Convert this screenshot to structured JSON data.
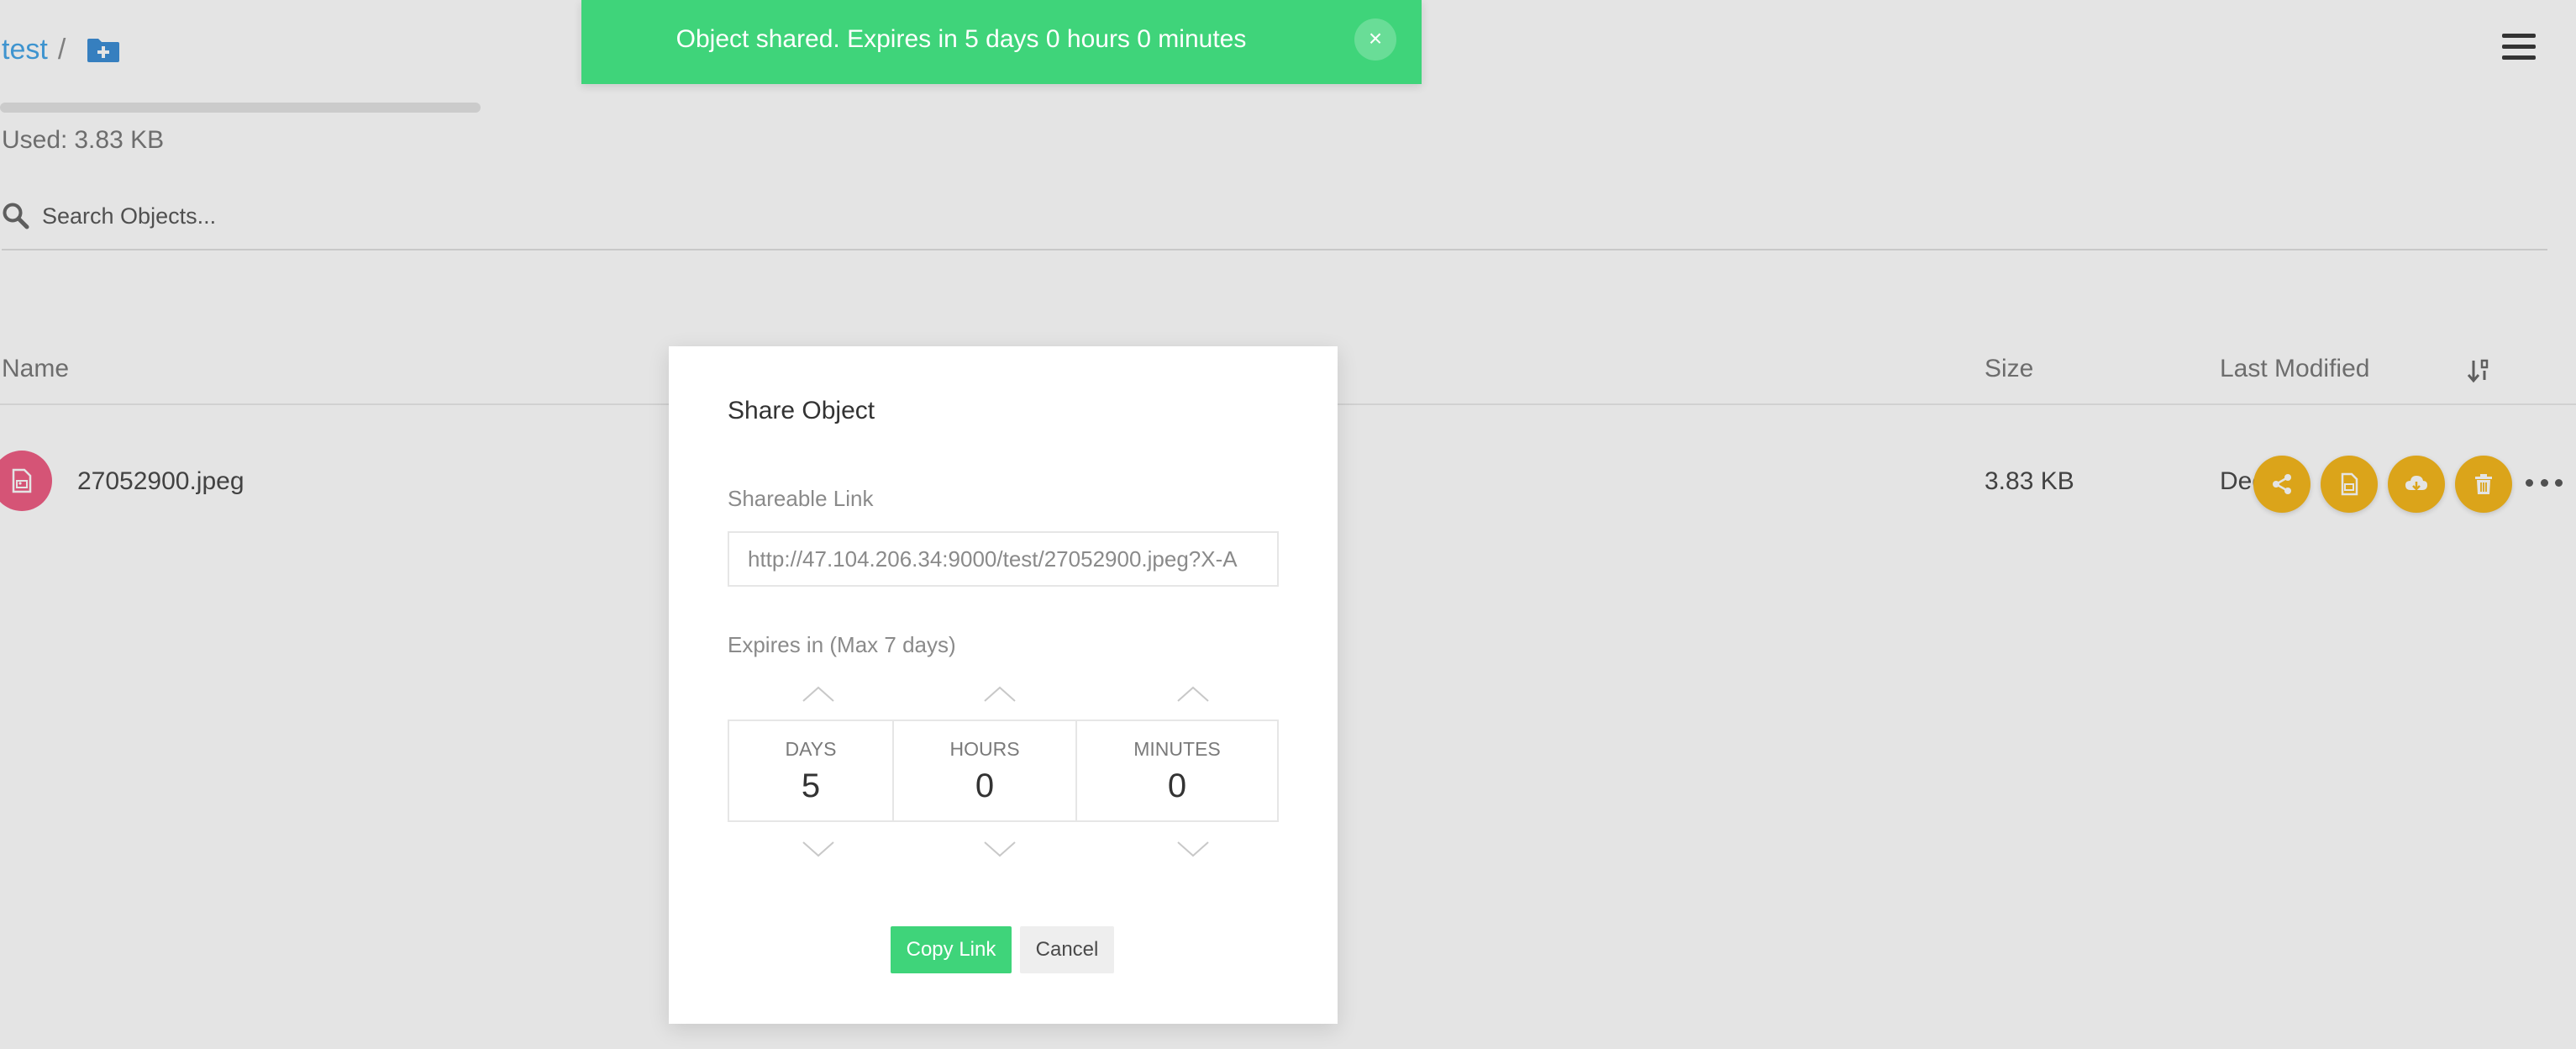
{
  "breadcrumb": {
    "bucket": "test",
    "separator": "/"
  },
  "storage": {
    "used_label": "Used:",
    "used_value": "3.83 KB",
    "usage_fraction": 0.0
  },
  "search": {
    "placeholder": "Search Objects..."
  },
  "table": {
    "columns": {
      "name": "Name",
      "size": "Size",
      "modified": "Last Modified"
    },
    "rows": [
      {
        "name": "27052900.jpeg",
        "size": "3.83 KB",
        "modified": "Dec"
      }
    ]
  },
  "toast": {
    "message": "Object shared. Expires in 5 days 0 hours 0 minutes",
    "close": "×"
  },
  "modal": {
    "title": "Share Object",
    "link_label": "Shareable Link",
    "link_value": "http://47.104.206.34:9000/test/27052900.jpeg?X-A",
    "expires_label": "Expires in (Max 7 days)",
    "days_label": "DAYS",
    "days_value": "5",
    "hours_label": "HOURS",
    "hours_value": "0",
    "minutes_label": "MINUTES",
    "minutes_value": "0",
    "copy_label": "Copy Link",
    "cancel_label": "Cancel"
  },
  "icons": {
    "new_folder": "folder-plus-icon",
    "search": "search-icon",
    "menu": "hamburger-menu-icon",
    "sort": "sort-icon",
    "file": "image-file-icon",
    "share": "share-icon",
    "preview": "file-preview-icon",
    "download": "cloud-download-icon",
    "delete": "trash-icon",
    "more": "more-horizontal-icon"
  },
  "colors": {
    "accent_blue": "#46a6e8",
    "success_green": "#3fd47a",
    "action_yellow": "#f5b81e",
    "file_pink": "#ef5e85"
  }
}
